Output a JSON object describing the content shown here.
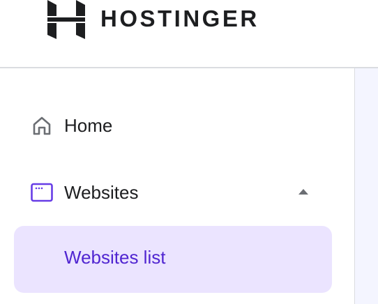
{
  "header": {
    "brand_name": "HOSTINGER",
    "logo_icon": "hostinger-logo-icon"
  },
  "sidebar": {
    "items": [
      {
        "label": "Home",
        "icon": "home-icon"
      },
      {
        "label": "Websites",
        "icon": "browser-window-icon",
        "expanded": true
      }
    ],
    "subitems": [
      {
        "label": "Websites list",
        "active": true
      }
    ]
  },
  "colors": {
    "active_text": "#5025d1",
    "active_background": "#ebe4ff",
    "browser_icon": "#673de6",
    "text": "#1d1e20",
    "divider": "#dadce0",
    "main_background": "#f4f5ff"
  }
}
